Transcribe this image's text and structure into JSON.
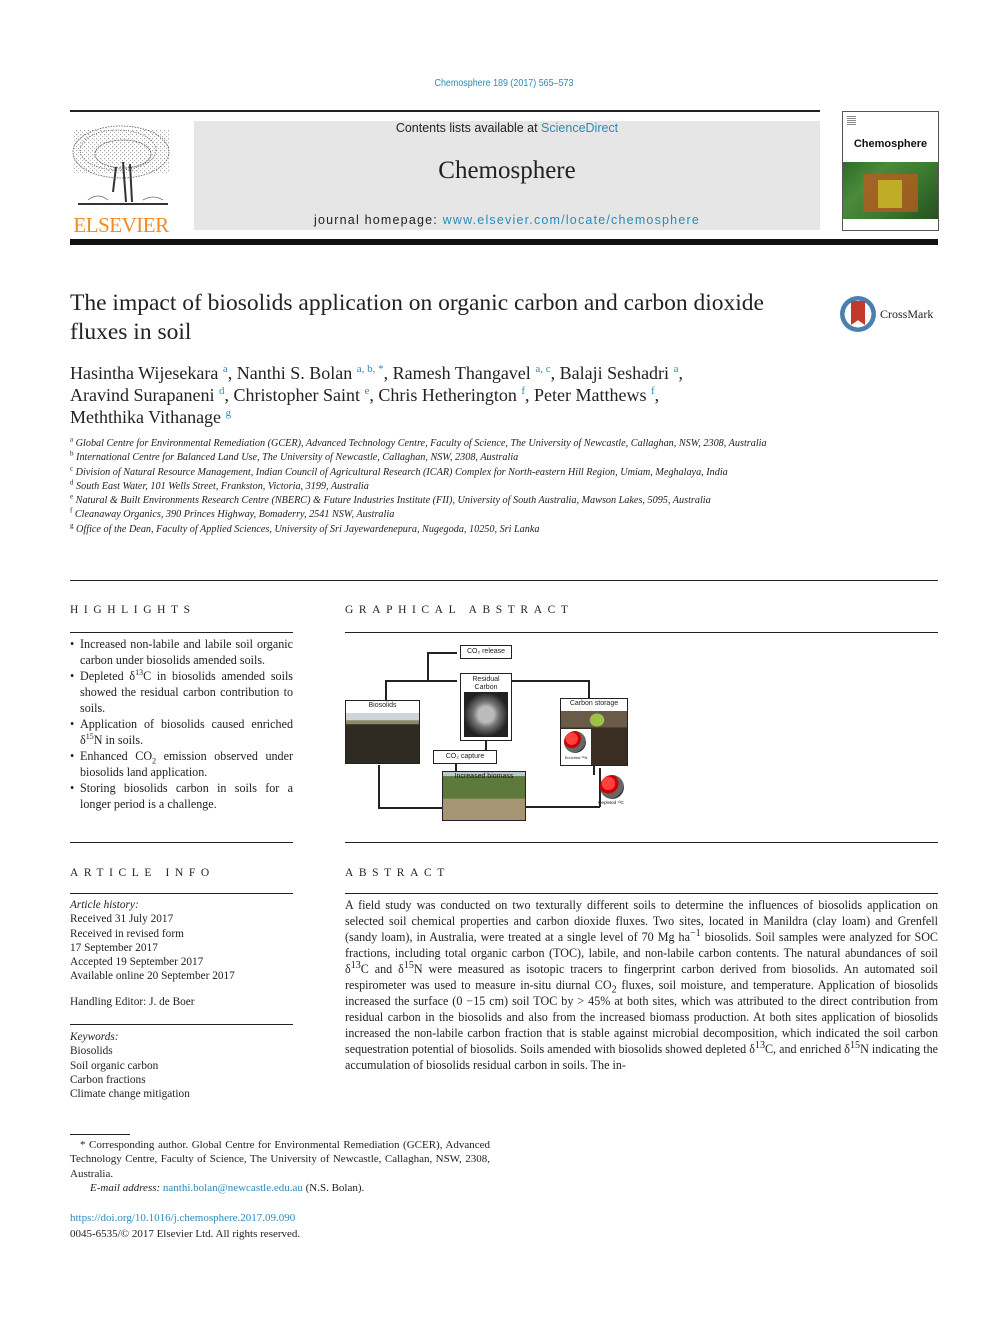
{
  "header": {
    "citation": "Chemosphere 189 (2017) 565–573",
    "contents_prefix": "Contents lists available at ",
    "contents_link": "ScienceDirect",
    "journal_name": "Chemosphere",
    "homepage_prefix": "journal homepage: ",
    "homepage_link": "www.elsevier.com/locate/chemosphere",
    "publisher_logo_text": "ELSEVIER",
    "cover_title": "Chemosphere",
    "crossmark_label": "CrossMark",
    "colors": {
      "link": "#2a8bb8",
      "elsevier_orange": "#f08a24",
      "banner_bg": "#e6e6e6"
    }
  },
  "article": {
    "title": "The impact of biosolids application on organic carbon and carbon dioxide fluxes in soil",
    "authors": [
      {
        "name": "Hasintha Wijesekara",
        "aff": "a"
      },
      {
        "name": "Nanthi S. Bolan",
        "aff": "a, b, *"
      },
      {
        "name": "Ramesh Thangavel",
        "aff": "a, c"
      },
      {
        "name": "Balaji Seshadri",
        "aff": "a"
      },
      {
        "name": "Aravind Surapaneni",
        "aff": "d"
      },
      {
        "name": "Christopher Saint",
        "aff": "e"
      },
      {
        "name": "Chris Hetherington",
        "aff": "f"
      },
      {
        "name": "Peter Matthews",
        "aff": "f"
      },
      {
        "name": "Meththika Vithanage",
        "aff": "g"
      }
    ],
    "affiliations": [
      {
        "key": "a",
        "text": "Global Centre for Environmental Remediation (GCER), Advanced Technology Centre, Faculty of Science, The University of Newcastle, Callaghan, NSW, 2308, Australia"
      },
      {
        "key": "b",
        "text": "International Centre for Balanced Land Use, The University of Newcastle, Callaghan, NSW, 2308, Australia"
      },
      {
        "key": "c",
        "text": "Division of Natural Resource Management, Indian Council of Agricultural Research (ICAR) Complex for North-eastern Hill Region, Umiam, Meghalaya, India"
      },
      {
        "key": "d",
        "text": "South East Water, 101 Wells Street, Frankston, Victoria, 3199, Australia"
      },
      {
        "key": "e",
        "text": "Natural & Built Environments Research Centre (NBERC) & Future Industries Institute (FII), University of South Australia, Mawson Lakes, 5095, Australia"
      },
      {
        "key": "f",
        "text": "Cleanaway Organics, 390 Princes Highway, Bomaderry, 2541 NSW, Australia"
      },
      {
        "key": "g",
        "text": "Office of the Dean, Faculty of Applied Sciences, University of Sri Jayewardenepura, Nugegoda, 10250, Sri Lanka"
      }
    ]
  },
  "highlights": {
    "heading": "HIGHLIGHTS",
    "items": [
      {
        "pre": "Increased non-labile and labile soil organic carbon under biosolids amended soils.",
        "sup": "",
        "post": ""
      },
      {
        "pre": "Depleted δ",
        "sup": "13",
        "post": "C in biosolids amended soils showed the residual carbon contribution to soils."
      },
      {
        "pre": "Application of biosolids caused enriched δ",
        "sup": "15",
        "post": "N in soils."
      },
      {
        "pre": "Enhanced CO",
        "sub": "2",
        "post": " emission observed under biosolids land application."
      },
      {
        "pre": "Storing biosolids carbon in soils for a longer period is a challenge.",
        "sup": "",
        "post": ""
      }
    ]
  },
  "graphical_abstract": {
    "heading": "GRAPHICAL ABSTRACT",
    "nodes": {
      "co2_release": "CO₂ release",
      "residual_carbon": "Residual Carbon",
      "biosolids": "Biosolids",
      "co2_capture": "CO₂ capture",
      "increased_biomass": "Increased biomass",
      "carbon_storage": "Carbon storage",
      "enriched_label": "Enriched ¹⁵N",
      "depleted_label": "Depleted ¹³C"
    }
  },
  "article_info": {
    "heading": "ARTICLE INFO",
    "history_label": "Article history:",
    "history": [
      "Received 31 July 2017",
      "Received in revised form",
      "17 September 2017",
      "Accepted 19 September 2017",
      "Available online 20 September 2017"
    ],
    "handling_editor": "Handling Editor: J. de Boer",
    "keywords_label": "Keywords:",
    "keywords": [
      "Biosolids",
      "Soil organic carbon",
      "Carbon fractions",
      "Climate change mitigation"
    ]
  },
  "abstract": {
    "heading": "ABSTRACT",
    "p1": "A field study was conducted on two texturally different soils to determine the influences of biosolids application on selected soil chemical properties and carbon dioxide fluxes. Two sites, located in Manildra (clay loam) and Grenfell (sandy loam), in Australia, were treated at a single level of 70 Mg ha",
    "p1_sup": "−1",
    "p2": " biosolids. Soil samples were analyzed for SOC fractions, including total organic carbon (TOC), labile, and non-labile carbon contents. The natural abundances of soil δ",
    "p2_sup": "13",
    "p3": "C and δ",
    "p3_sup": "15",
    "p4": "N were measured as isotopic tracers to fingerprint carbon derived from biosolids. An automated soil respirometer was used to measure in-situ diurnal CO",
    "p4_sub": "2",
    "p5": " fluxes, soil moisture, and temperature. Application of biosolids increased the surface (0 −15 cm) soil TOC by > 45% at both sites, which was attributed to the direct contribution from residual carbon in the biosolids and also from the increased biomass production. At both sites application of biosolids increased the non-labile carbon fraction that is stable against microbial decomposition, which indicated the soil carbon sequestration potential of biosolids. Soils amended with biosolids showed depleted δ",
    "p5_sup": "13",
    "p6": "C, and enriched δ",
    "p6_sup": "15",
    "p7": "N indicating the accumulation of biosolids residual carbon in soils. The in-"
  },
  "footnote": {
    "corresponding": "* Corresponding author. Global Centre for Environmental Remediation (GCER), Advanced Technology Centre, Faculty of Science, The University of Newcastle, Callaghan, NSW, 2308, Australia.",
    "email_label": "E-mail address: ",
    "email": "nanthi.bolan@newcastle.edu.au",
    "email_suffix": " (N.S. Bolan).",
    "doi": "https://doi.org/10.1016/j.chemosphere.2017.09.090",
    "copyright": "0045-6535/© 2017 Elsevier Ltd. All rights reserved."
  }
}
